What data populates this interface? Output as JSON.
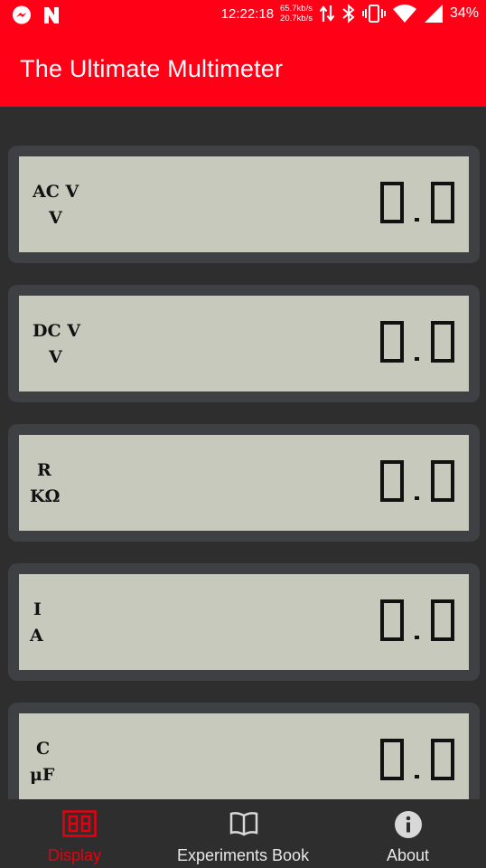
{
  "status_bar": {
    "time": "12:22:18",
    "speed_up": "65.7kb/s",
    "speed_down": "20.7kb/s",
    "battery": "34%",
    "icons": [
      "messenger-icon",
      "n-logo-icon",
      "data-arrows-icon",
      "bluetooth-icon",
      "vibrate-icon",
      "wifi-icon",
      "signal-icon"
    ]
  },
  "app_bar": {
    "title": "The Ultimate Multimeter"
  },
  "meters": [
    {
      "label1": "AC V",
      "label2": "V",
      "value": "0.0"
    },
    {
      "label1": "DC V",
      "label2": "V",
      "value": "0.0"
    },
    {
      "label1": "R",
      "label2": "KΩ",
      "value": "0.0"
    },
    {
      "label1": "I",
      "label2": "A",
      "value": "0.0"
    },
    {
      "label1": "C",
      "label2": "μF",
      "value": "0.0"
    }
  ],
  "bottom_nav": {
    "items": [
      {
        "label": "Display",
        "icon": "seven-segment-icon",
        "active": true
      },
      {
        "label": "Experiments Book",
        "icon": "book-icon",
        "active": false
      },
      {
        "label": "About",
        "icon": "info-icon",
        "active": false
      }
    ],
    "active_color": "#e8000f"
  },
  "colors": {
    "brand_red": "#ff0016",
    "background": "#2e2e2e",
    "lcd": "#c8c9bd",
    "bezel": "#3e4043"
  }
}
